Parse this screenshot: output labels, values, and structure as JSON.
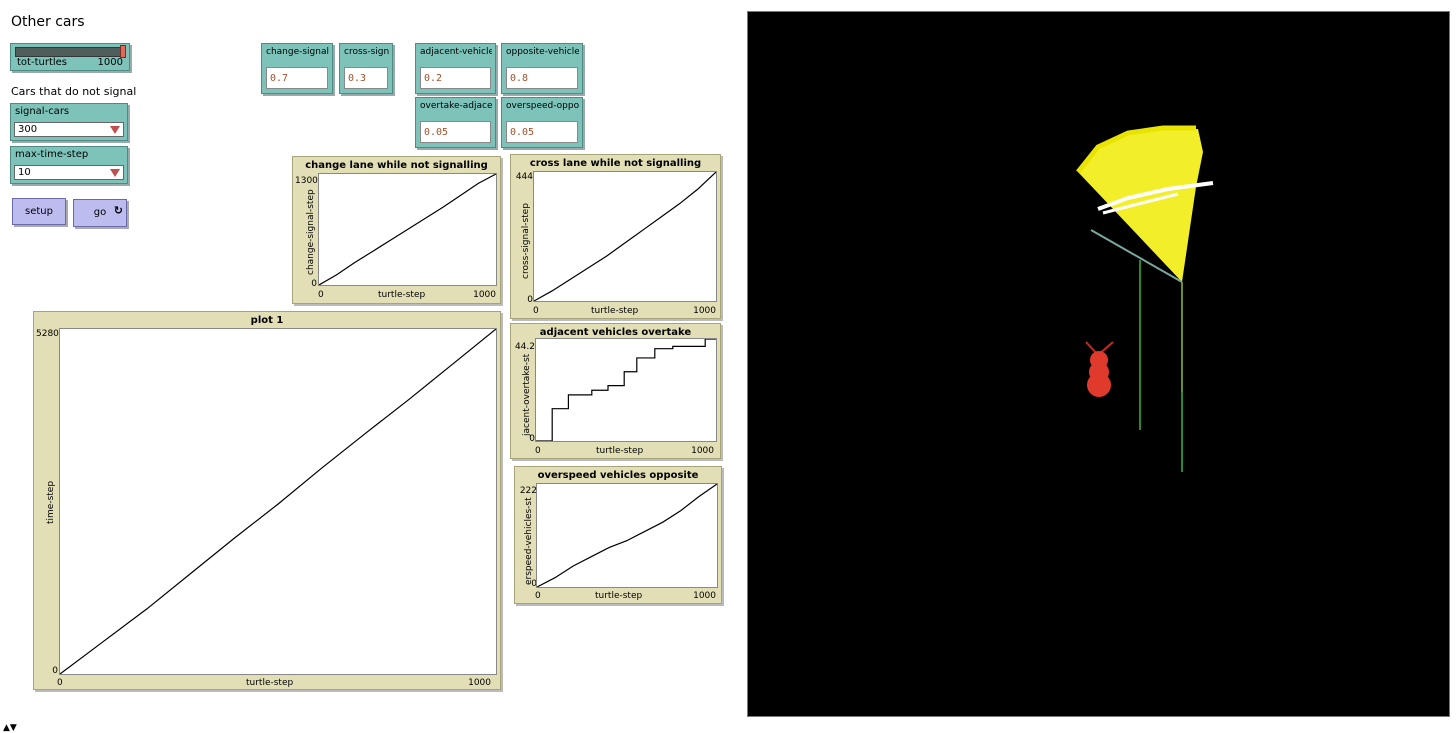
{
  "header": {
    "title": "Other cars"
  },
  "slider_tot_turtles": {
    "label": "tot-turtles",
    "value": "1000",
    "fraction": 1.0
  },
  "note": "Cars that do not signal",
  "chooser_signal_cars": {
    "label": "signal-cars",
    "value": "300"
  },
  "chooser_max_time_step": {
    "label": "max-time-step",
    "value": "10"
  },
  "buttons": {
    "setup": "setup",
    "go": "go",
    "go_forever_glyph": "↻"
  },
  "inputs": {
    "change_signal": {
      "label": "change-signal",
      "value": "0.7"
    },
    "cross_signal": {
      "label": "cross-signal",
      "value": "0.3"
    },
    "adjacent_vehicles": {
      "label": "adjacent-vehicles",
      "value": "0.2"
    },
    "opposite_vehicles": {
      "label": "opposite-vehicles",
      "value": "0.8"
    },
    "overtake_adjacent": {
      "label": "overtake-adjacent",
      "value": "0.05"
    },
    "overspeed_opposite": {
      "label": "overspeed-oppos...",
      "value": "0.05"
    }
  },
  "plots": {
    "change_lane": {
      "title": "change lane while not signalling",
      "ymax": "1300",
      "ymin": "0",
      "xmin": "0",
      "xmax": "1000",
      "xlabel": "turtle-step",
      "ylabel": "change-signal-step"
    },
    "cross_lane": {
      "title": "cross lane while not signalling",
      "ymax": "444",
      "ymin": "0",
      "xmin": "0",
      "xmax": "1000",
      "xlabel": "turtle-step",
      "ylabel": "cross-signal-step"
    },
    "plot1": {
      "title": "plot 1",
      "ymax": "5280",
      "ymin": "0",
      "xmin": "0",
      "xmax": "1000",
      "xlabel": "turtle-step",
      "ylabel": "time-step"
    },
    "adjacent": {
      "title": "adjacent vehicles overtake",
      "ymax": "44.2",
      "ymin": "0",
      "xmin": "0",
      "xmax": "1000",
      "xlabel": "turtle-step",
      "ylabel": "jacent-overtake-st"
    },
    "overspeed": {
      "title": "overspeed vehicles opposite",
      "ymax": "222",
      "ymin": "0",
      "xmin": "0",
      "xmax": "1000",
      "xlabel": "turtle-step",
      "ylabel": "erspeed-vehicles-st"
    }
  },
  "chart_data": [
    {
      "type": "line",
      "title": "change lane while not signalling",
      "xlabel": "turtle-step",
      "ylabel": "change-signal-step",
      "xlim": [
        0,
        1000
      ],
      "ylim": [
        0,
        1300
      ],
      "x": [
        0,
        100,
        200,
        300,
        400,
        500,
        600,
        700,
        800,
        900,
        1000
      ],
      "y": [
        0,
        120,
        260,
        390,
        520,
        650,
        780,
        910,
        1050,
        1190,
        1300
      ]
    },
    {
      "type": "line",
      "title": "cross lane while not signalling",
      "xlabel": "turtle-step",
      "ylabel": "cross-signal-step",
      "xlim": [
        0,
        1000
      ],
      "ylim": [
        0,
        444
      ],
      "x": [
        0,
        100,
        200,
        300,
        400,
        500,
        600,
        700,
        800,
        900,
        1000
      ],
      "y": [
        0,
        35,
        75,
        115,
        155,
        200,
        245,
        290,
        335,
        385,
        444
      ]
    },
    {
      "type": "line",
      "title": "plot 1",
      "xlabel": "turtle-step",
      "ylabel": "time-step",
      "xlim": [
        0,
        1000
      ],
      "ylim": [
        0,
        5280
      ],
      "x": [
        0,
        100,
        200,
        300,
        400,
        500,
        600,
        700,
        800,
        900,
        1000
      ],
      "y": [
        0,
        500,
        1000,
        1540,
        2080,
        2600,
        3150,
        3680,
        4200,
        4740,
        5280
      ]
    },
    {
      "type": "line",
      "title": "adjacent vehicles overtake",
      "xlabel": "turtle-step",
      "ylabel": "jacent-overtake-st",
      "xlim": [
        0,
        1000
      ],
      "ylim": [
        0,
        44.2
      ],
      "x": [
        0,
        90,
        90,
        180,
        180,
        310,
        310,
        400,
        400,
        490,
        490,
        560,
        560,
        660,
        660,
        760,
        760,
        940,
        940,
        1000
      ],
      "y": [
        0,
        0,
        14,
        14,
        20,
        20,
        22,
        22,
        24,
        24,
        30,
        30,
        36,
        36,
        40,
        40,
        41,
        41,
        44.2,
        44.2
      ]
    },
    {
      "type": "line",
      "title": "overspeed vehicles opposite",
      "xlabel": "turtle-step",
      "ylabel": "erspeed-vehicles-st",
      "xlim": [
        0,
        1000
      ],
      "ylim": [
        0,
        222
      ],
      "x": [
        0,
        100,
        200,
        300,
        400,
        500,
        600,
        700,
        800,
        900,
        1000
      ],
      "y": [
        0,
        20,
        45,
        65,
        85,
        100,
        120,
        140,
        165,
        195,
        222
      ]
    }
  ]
}
